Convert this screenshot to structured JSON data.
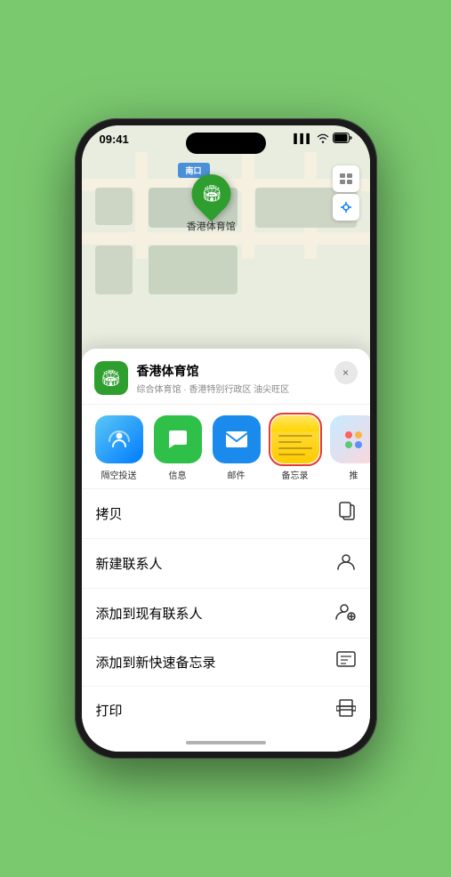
{
  "statusBar": {
    "time": "09:41",
    "signal": "▌▌▌",
    "wifi": "wifi",
    "battery": "battery"
  },
  "map": {
    "label": "南口",
    "pinLabel": "香港体育馆"
  },
  "bottomSheet": {
    "venueName": "香港体育馆",
    "venueSub": "综合体育馆 · 香港特别行政区 油尖旺区",
    "closeLabel": "×",
    "shareItems": [
      {
        "id": "airdrop",
        "label": "隔空投送",
        "emoji": "📡"
      },
      {
        "id": "messages",
        "label": "信息",
        "emoji": "💬"
      },
      {
        "id": "mail",
        "label": "邮件",
        "emoji": "✉️"
      },
      {
        "id": "notes",
        "label": "备忘录",
        "emoji": ""
      },
      {
        "id": "more",
        "label": "推",
        "emoji": "⋯"
      }
    ],
    "actionItems": [
      {
        "id": "copy",
        "label": "拷贝",
        "icon": "⎘"
      },
      {
        "id": "new-contact",
        "label": "新建联系人",
        "icon": "👤"
      },
      {
        "id": "add-existing",
        "label": "添加到现有联系人",
        "icon": "👤"
      },
      {
        "id": "add-note",
        "label": "添加到新快速备忘录",
        "icon": "🗒"
      },
      {
        "id": "print",
        "label": "打印",
        "icon": "🖨"
      }
    ]
  }
}
